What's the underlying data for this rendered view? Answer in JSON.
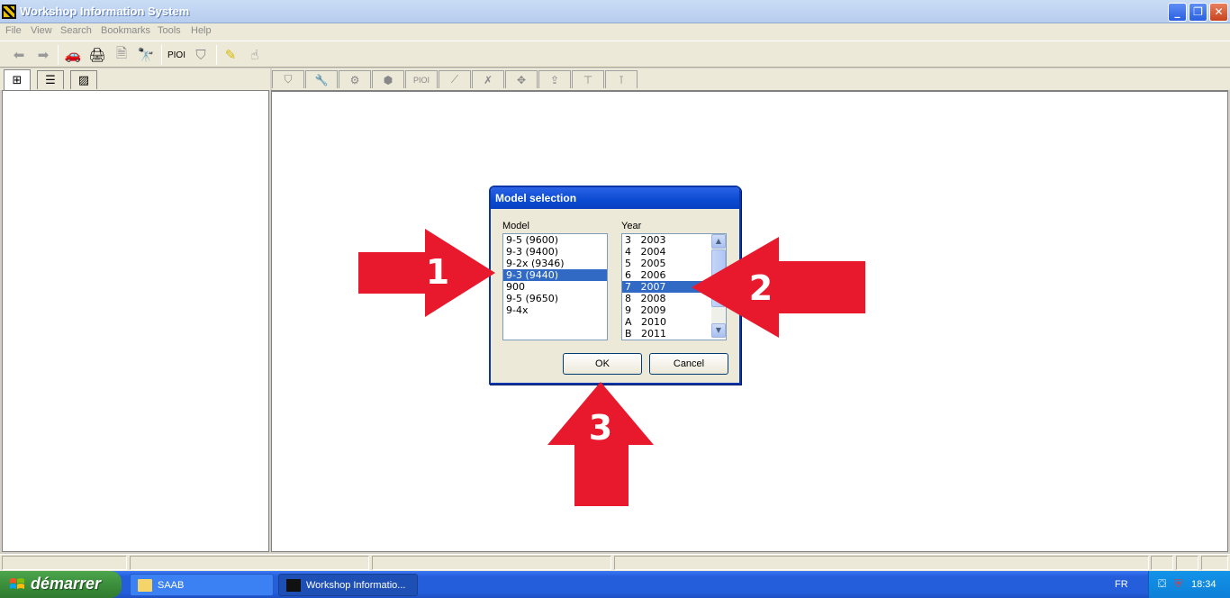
{
  "window": {
    "title": "Workshop Information System"
  },
  "menu": [
    "File",
    "View",
    "Search",
    "Bookmarks",
    "Tools",
    "Help"
  ],
  "toolbar": {
    "pioi_label": "PIOI"
  },
  "right_tabs": {
    "pioi_label": "PIOI"
  },
  "dialog": {
    "title": "Model selection",
    "model_label": "Model",
    "year_label": "Year",
    "models": [
      "9-5 (9600)",
      "9-3 (9400)",
      "9-2x (9346)",
      "9-3 (9440)",
      "900",
      "9-5 (9650)",
      "9-4x"
    ],
    "selected_model": "9-3 (9440)",
    "years": [
      "3   2003",
      "4   2004",
      "5   2005",
      "6   2006",
      "7   2007",
      "8   2008",
      "9   2009",
      "A   2010",
      "B   2011"
    ],
    "selected_year": "7   2007",
    "ok_label": "OK",
    "cancel_label": "Cancel"
  },
  "annotations": [
    "1",
    "2",
    "3"
  ],
  "taskbar": {
    "start_label": "démarrer",
    "tasks": [
      "SAAB",
      "Workshop Informatio..."
    ],
    "language": "FR",
    "clock": "18:34"
  },
  "colors": {
    "selection": "#316ac5",
    "annotation_arrow": "#e8192c",
    "titlebar_active": "#0a4ad2"
  }
}
